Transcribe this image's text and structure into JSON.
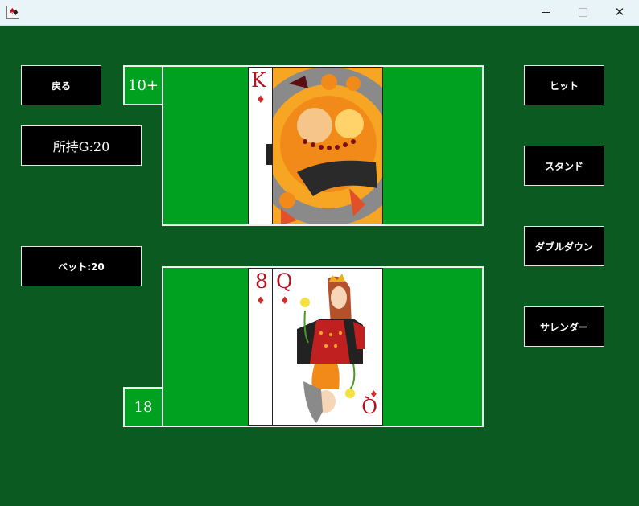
{
  "window": {
    "icon": "playing-cards-icon",
    "controls": {
      "minimize": "minimize-icon",
      "maximize": "maximize-icon",
      "close": "close-icon"
    }
  },
  "buttons": {
    "back": "戻る",
    "hit": "ヒット",
    "stand": "スタンド",
    "double_down": "ダブルダウン",
    "surrender": "サレンダー"
  },
  "status": {
    "gold": "所持G:20",
    "bet": "ベット:20"
  },
  "dealer": {
    "score": "10+",
    "cards": [
      {
        "rank": "K",
        "suit": "♦",
        "state": "face-up"
      },
      {
        "state": "face-down"
      }
    ]
  },
  "player": {
    "score": "18",
    "cards": [
      {
        "rank": "8",
        "suit": "♦",
        "state": "face-up"
      },
      {
        "rank": "Q",
        "suit": "♦",
        "state": "face-up"
      }
    ]
  },
  "colors": {
    "background": "#0a5a22",
    "table": "#00a020",
    "button": "#000000",
    "card_red": "#b8101e"
  }
}
